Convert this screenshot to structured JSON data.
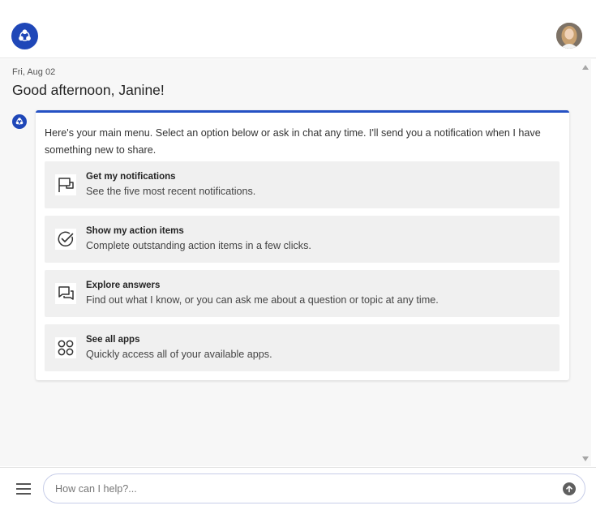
{
  "header": {
    "logo_icon": "cluster-logo-icon",
    "avatar_icon": "user-avatar"
  },
  "chat": {
    "date": "Fri, Aug 02",
    "greeting": "Good afternoon, Janine!",
    "bot_icon": "bot-avatar-icon",
    "intro": "Here's your main menu. Select an option below or ask in chat any time. I'll send you a notification when I have something new to share.",
    "options": [
      {
        "title": "Get my notifications",
        "description": "See the five most recent notifications.",
        "icon": "flag-icon"
      },
      {
        "title": "Show my action items",
        "description": "Complete outstanding action items in a few clicks.",
        "icon": "check-circle-icon"
      },
      {
        "title": "Explore answers",
        "description": "Find out what I know, or you can ask me about a question or topic at any time.",
        "icon": "chat-bubbles-icon"
      },
      {
        "title": "See all apps",
        "description": "Quickly access all of your available apps.",
        "icon": "apps-grid-icon"
      }
    ]
  },
  "composer": {
    "menu_icon": "hamburger-menu-icon",
    "placeholder": "How can I help?...",
    "value": "",
    "send_icon": "send-arrow-icon"
  },
  "colors": {
    "brand": "#1f47b8",
    "card_accent": "#2551c4",
    "background": "#f7f7f7",
    "option_bg": "#f0f0f0"
  }
}
